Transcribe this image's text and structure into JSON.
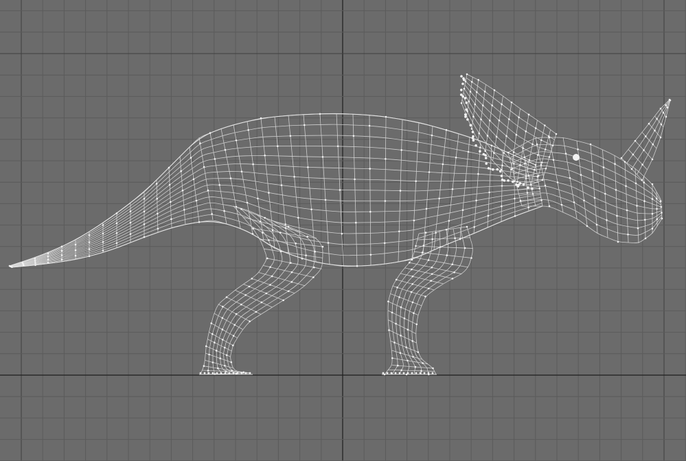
{
  "viewport": {
    "view": "side",
    "mode": "wireframe",
    "model": "dinosaur-mesh",
    "colors": {
      "background": "#6b6b6b",
      "grid": "#5b5b5b",
      "grid_major": "#3f3f3f",
      "axis": "#1e1e1e",
      "wire": "#d9d9d9",
      "vertex": "#f2f2f2"
    }
  }
}
